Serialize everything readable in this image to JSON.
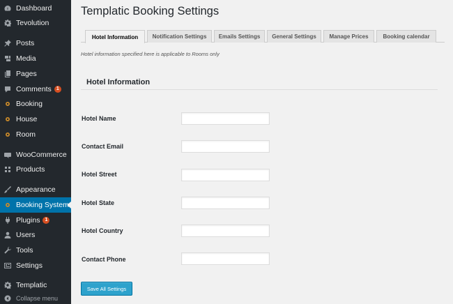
{
  "sidebar": {
    "items": [
      {
        "label": "Dashboard",
        "icon": "dashboard-icon"
      },
      {
        "label": "Tevolution",
        "icon": "gear-icon"
      },
      {
        "label": "Posts",
        "icon": "pin-icon"
      },
      {
        "label": "Media",
        "icon": "media-icon"
      },
      {
        "label": "Pages",
        "icon": "pages-icon"
      },
      {
        "label": "Comments",
        "icon": "comment-icon",
        "badge": "1"
      },
      {
        "label": "Booking",
        "icon": "plugin-gear-icon"
      },
      {
        "label": "House",
        "icon": "plugin-gear-icon"
      },
      {
        "label": "Room",
        "icon": "plugin-gear-icon"
      },
      {
        "label": "WooCommerce",
        "icon": "woocommerce-icon"
      },
      {
        "label": "Products",
        "icon": "products-icon"
      },
      {
        "label": "Appearance",
        "icon": "brush-icon"
      },
      {
        "label": "Booking System",
        "icon": "plugin-gear-icon",
        "active": true
      },
      {
        "label": "Plugins",
        "icon": "plug-icon",
        "badge": "1"
      },
      {
        "label": "Users",
        "icon": "user-icon"
      },
      {
        "label": "Tools",
        "icon": "wrench-icon"
      },
      {
        "label": "Settings",
        "icon": "settings-icon"
      },
      {
        "label": "Templatic",
        "icon": "gear-icon"
      }
    ],
    "collapse_label": "Collapse menu"
  },
  "page": {
    "title": "Templatic Booking Settings",
    "intro": "Hotel information specified here is applicable to Rooms only",
    "section_title": "Hotel Information"
  },
  "tabs": [
    {
      "label": "Hotel Information",
      "active": true
    },
    {
      "label": "Notification Settings"
    },
    {
      "label": "Emails Settings"
    },
    {
      "label": "General Settings"
    },
    {
      "label": "Manage Prices"
    },
    {
      "label": "Booking calendar"
    }
  ],
  "fields": [
    {
      "label": "Hotel Name",
      "value": ""
    },
    {
      "label": "Contact Email",
      "value": ""
    },
    {
      "label": "Hotel Street",
      "value": ""
    },
    {
      "label": "Hotel State",
      "value": ""
    },
    {
      "label": "Hotel Country",
      "value": ""
    },
    {
      "label": "Contact Phone",
      "value": ""
    }
  ],
  "save_button": "Save All Settings",
  "colors": {
    "sidebar_bg": "#23282d",
    "active_menu": "#0073aa",
    "badge": "#d54e21",
    "primary_button": "#2ea2cc"
  }
}
